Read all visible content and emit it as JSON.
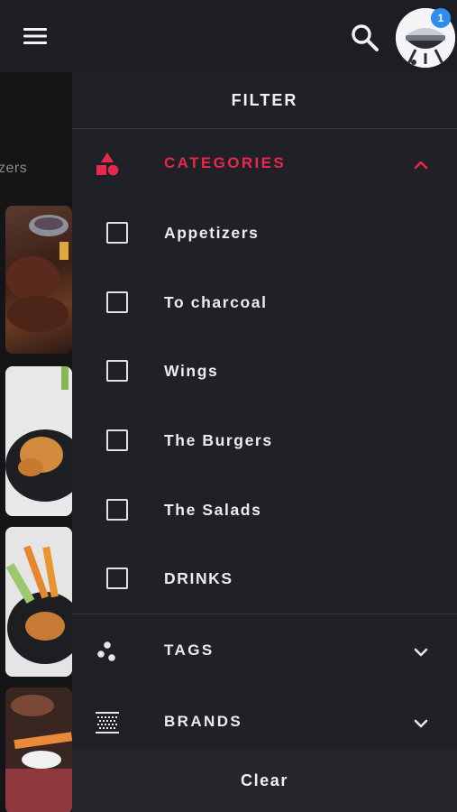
{
  "appbar": {
    "menu_icon": "hamburger-menu-icon",
    "search_icon": "search-icon",
    "avatar_icon": "grill-avatar",
    "badge_count": "1"
  },
  "background": {
    "category_fragment": "zers"
  },
  "filter": {
    "title": "FILTER",
    "sections": {
      "categories": {
        "label": "CATEGORIES",
        "icon": "shapes-icon",
        "expanded": true,
        "accent": "#e8284a",
        "items": [
          {
            "label": "Appetizers",
            "checked": false
          },
          {
            "label": "To charcoal",
            "checked": false
          },
          {
            "label": "Wings",
            "checked": false
          },
          {
            "label": "The Burgers",
            "checked": false
          },
          {
            "label": "The Salads",
            "checked": false
          },
          {
            "label": "DRINKS",
            "checked": false
          }
        ]
      },
      "tags": {
        "label": "TAGS",
        "icon": "dots-icon",
        "expanded": false
      },
      "brands": {
        "label": "BRANDS",
        "icon": "barcode-icon",
        "expanded": false
      }
    },
    "clear_label": "Clear"
  }
}
